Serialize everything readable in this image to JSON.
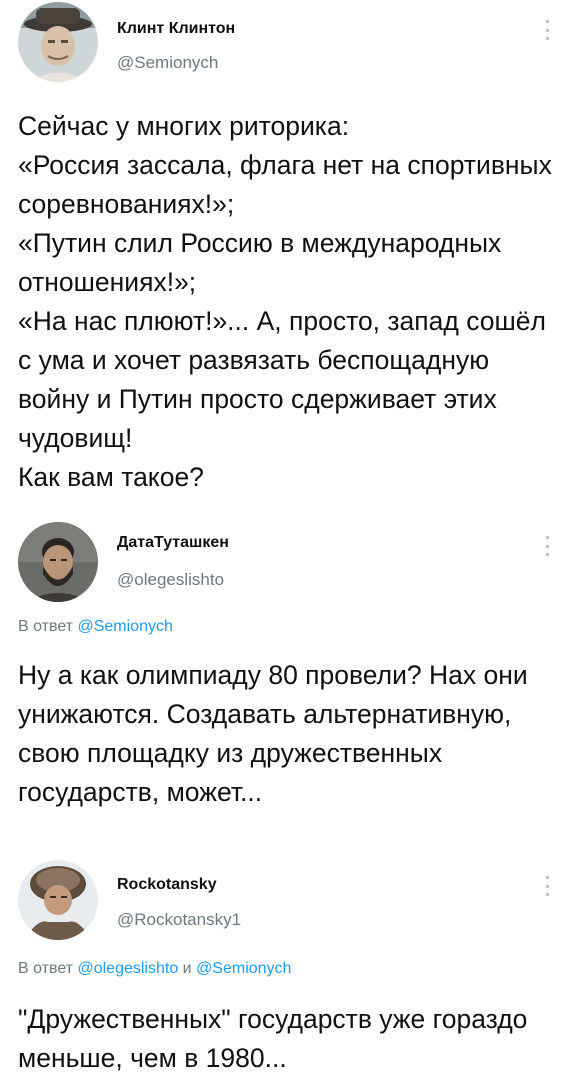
{
  "tweets": [
    {
      "display_name": "Клинт Клинтон",
      "handle": "@Semionych",
      "avatar": "avatar-man-in-hat",
      "text": "Сейчас у многих риторика:\n«Россия зассала, флага нет на спортивных соревнованиях!»;\n«Путин слил Россию в международных отношениях!»;\n«На нас плюют!»... А, просто, запад сошёл с ума и хочет развязать беспощадную войну и Путин просто сдерживает этих чудовищ!\nКак вам такое?"
    },
    {
      "display_name": "ДатаТуташкен",
      "handle": "@olegeslishto",
      "avatar": "avatar-bearded-man",
      "reply_prefix": "В ответ",
      "reply_mentions": [
        "@Semionych"
      ],
      "text": "Ну а как олимпиаду 80 провели? Нах они унижаются. Создавать альтернативную, свою площадку из дружественных государств, может..."
    },
    {
      "display_name": "Rockotansky",
      "handle": "@Rockotansky1",
      "avatar": "avatar-old-man-fur-hat",
      "reply_prefix": "В ответ",
      "reply_mentions": [
        "@olegeslishto",
        "@Semionych"
      ],
      "reply_joiner": "и",
      "text": "\"Дружественных\" государств уже гораздо меньше, чем в 1980..."
    }
  ],
  "colors": {
    "text": "#111111",
    "secondary": "#6e7880",
    "accent": "#1d9bf0"
  }
}
